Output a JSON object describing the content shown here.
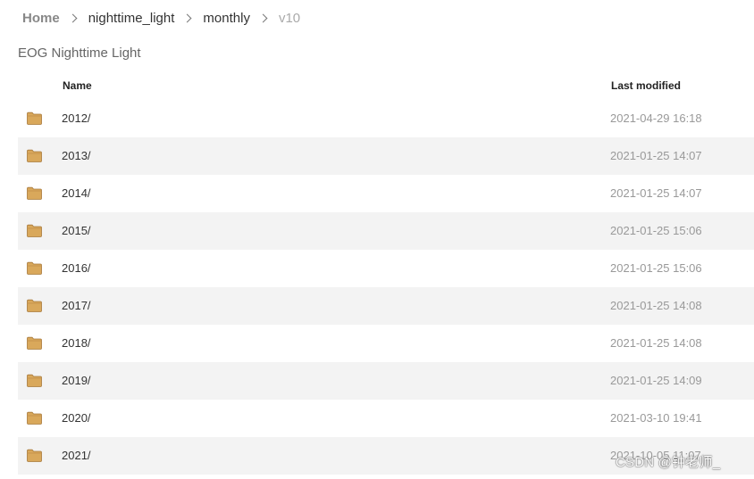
{
  "breadcrumb": {
    "items": [
      {
        "label": "Home"
      },
      {
        "label": "nighttime_light"
      },
      {
        "label": "monthly"
      },
      {
        "label": "v10"
      }
    ]
  },
  "page": {
    "title": "EOG Nighttime Light"
  },
  "table": {
    "headers": {
      "name": "Name",
      "modified": "Last modified"
    },
    "rows": [
      {
        "name": "2012/",
        "modified": "2021-04-29 16:18"
      },
      {
        "name": "2013/",
        "modified": "2021-01-25 14:07"
      },
      {
        "name": "2014/",
        "modified": "2021-01-25 14:07"
      },
      {
        "name": "2015/",
        "modified": "2021-01-25 15:06"
      },
      {
        "name": "2016/",
        "modified": "2021-01-25 15:06"
      },
      {
        "name": "2017/",
        "modified": "2021-01-25 14:08"
      },
      {
        "name": "2018/",
        "modified": "2021-01-25 14:08"
      },
      {
        "name": "2019/",
        "modified": "2021-01-25 14:09"
      },
      {
        "name": "2020/",
        "modified": "2021-03-10 19:41"
      },
      {
        "name": "2021/",
        "modified": "2021-10-05 11:07"
      }
    ]
  },
  "watermark": "CSDN @钟老师_",
  "icons": {
    "folder": "folder-icon",
    "separator": "chevron-right-icon"
  },
  "colors": {
    "folder": "#d9a85b",
    "row_alt_bg": "#f3f3f3",
    "date_text": "#999999"
  }
}
